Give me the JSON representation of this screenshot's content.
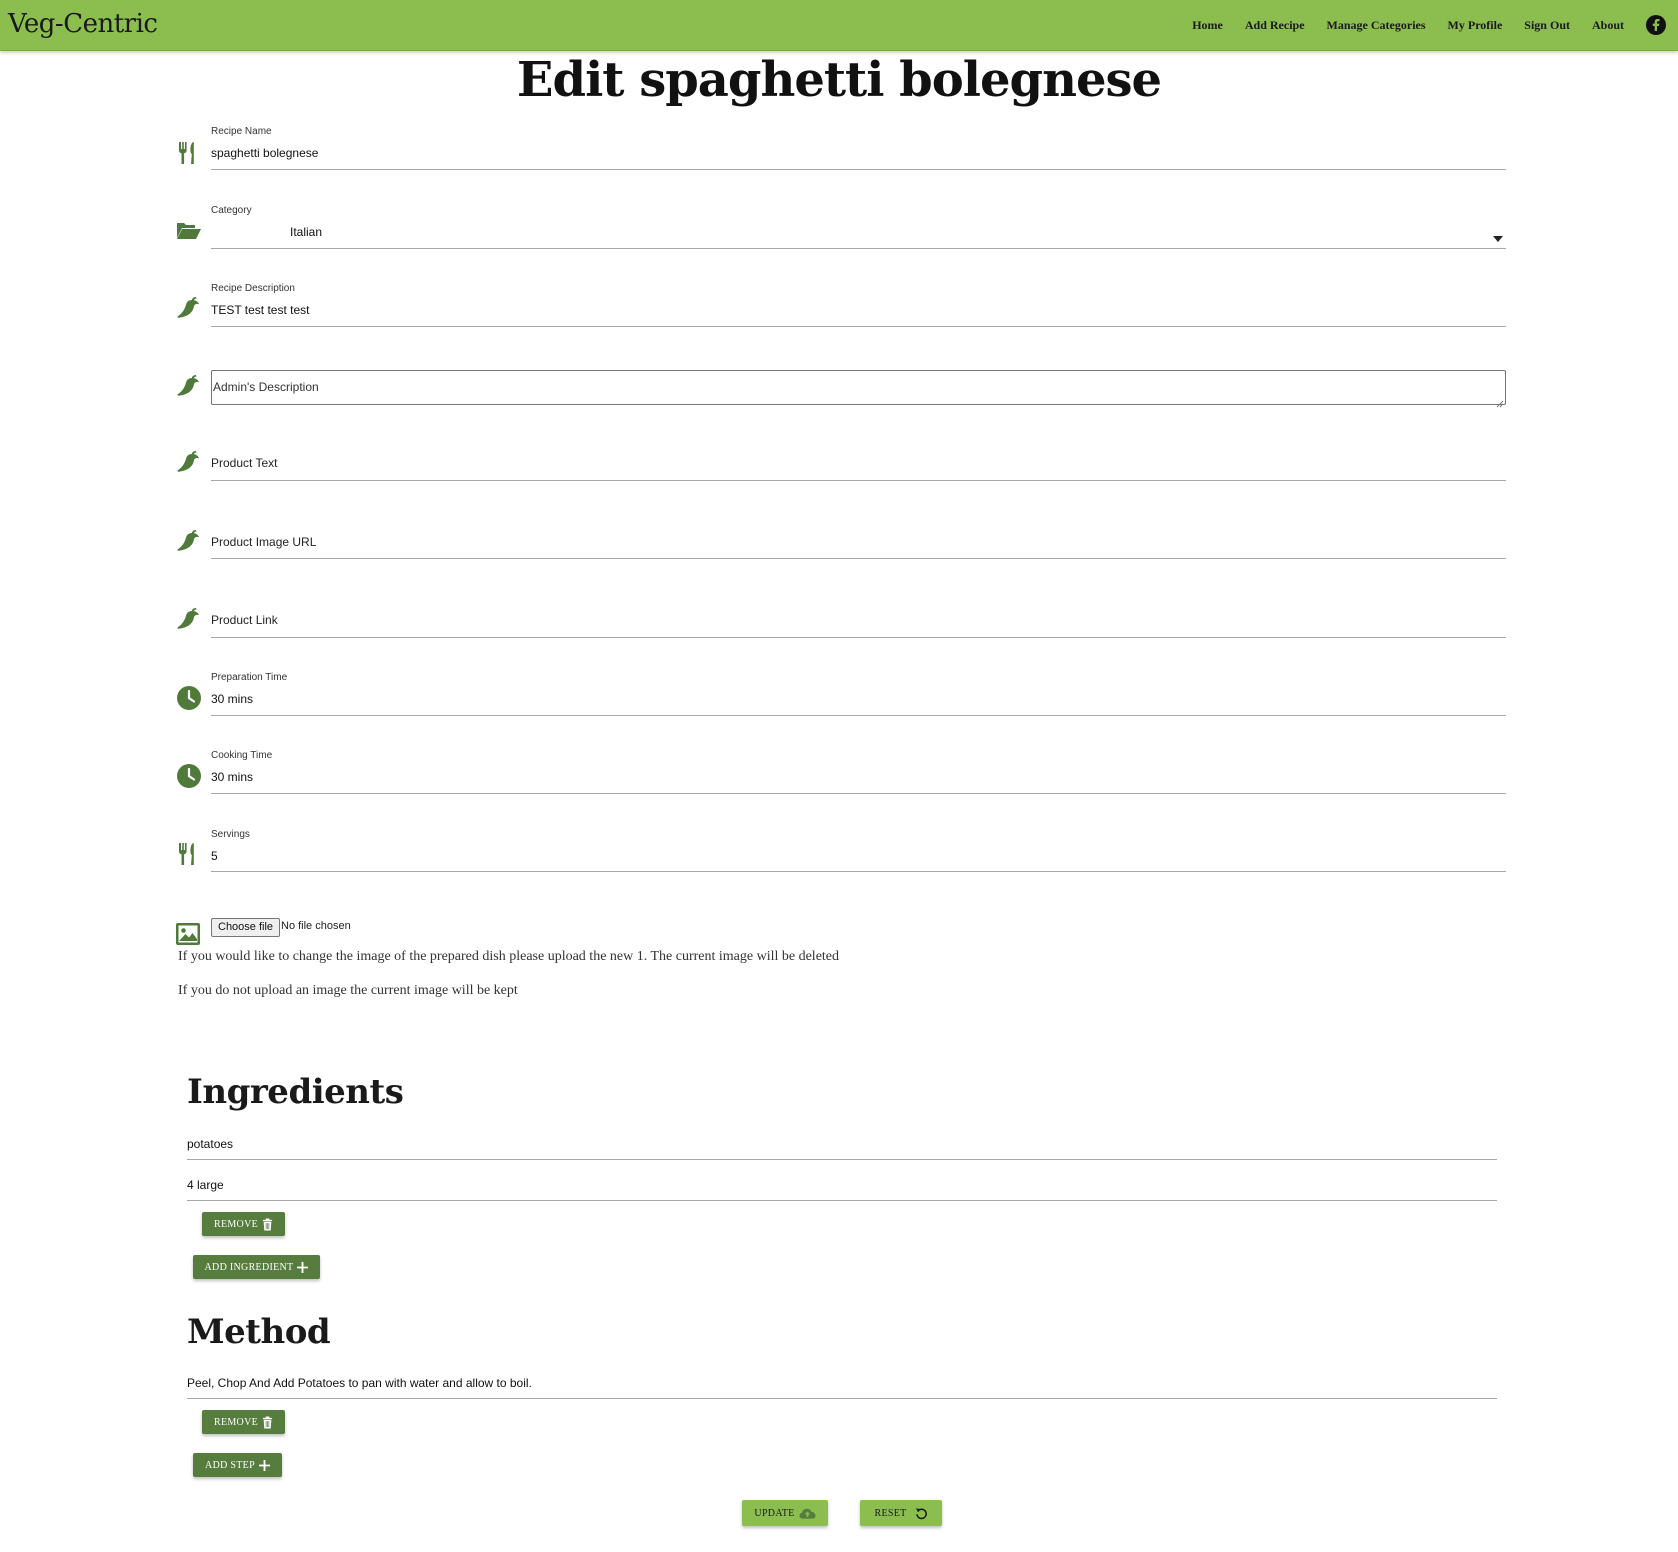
{
  "app": {
    "brand": "Veg-Centric",
    "nav": [
      "Home",
      "Add Recipe",
      "Manage Categories",
      "My Profile",
      "Sign Out",
      "About"
    ],
    "social_icon": "facebook-icon"
  },
  "page": {
    "title": "Edit spaghetti bolegnese"
  },
  "form": {
    "recipe_name": {
      "label": "Recipe Name",
      "value": "spaghetti bolegnese",
      "icon": "utensils-icon"
    },
    "category": {
      "label": "Category",
      "value": "Italian",
      "icon": "folder-open-icon"
    },
    "recipe_description": {
      "label": "Recipe Description",
      "value": "TEST test test test",
      "icon": "pepper-icon"
    },
    "admin_description": {
      "placeholder": "Admin's Description",
      "icon": "pepper-icon"
    },
    "product_text": {
      "placeholder": "Product Text",
      "icon": "pepper-icon"
    },
    "product_image_url": {
      "placeholder": "Product Image URL",
      "icon": "pepper-icon"
    },
    "product_link": {
      "placeholder": "Product Link",
      "icon": "pepper-icon"
    },
    "preparation_time": {
      "label": "Preparation Time",
      "value": "30 mins",
      "icon": "clock-icon"
    },
    "cooking_time": {
      "label": "Cooking Time",
      "value": "30 mins",
      "icon": "clock-icon"
    },
    "servings": {
      "label": "Servings",
      "value": "5",
      "icon": "utensils-icon"
    },
    "image_upload": {
      "button": "Choose file",
      "status": "No file chosen",
      "icon": "image-icon",
      "note1": "If you would like to change the image of the prepared dish please upload the new 1. The current image will be deleted",
      "note2": "If you do not upload an image the current image will be kept"
    }
  },
  "ingredients": {
    "title": "Ingredients",
    "items": [
      {
        "name": "potatoes",
        "quantity": "4 large"
      }
    ],
    "remove_label": "REMOVE",
    "add_label": "ADD INGREDIENT"
  },
  "method": {
    "title": "Method",
    "steps": [
      "Peel, Chop And Add Potatoes to pan with water and allow to boil."
    ],
    "remove_label": "REMOVE",
    "add_label": "ADD STEP"
  },
  "actions": {
    "update_label": "UPDATE",
    "reset_label": "RESET"
  },
  "colors": {
    "navbar": "#8bbd4f",
    "accent_dark": "#567d3e",
    "icon": "#4f7a3a"
  }
}
